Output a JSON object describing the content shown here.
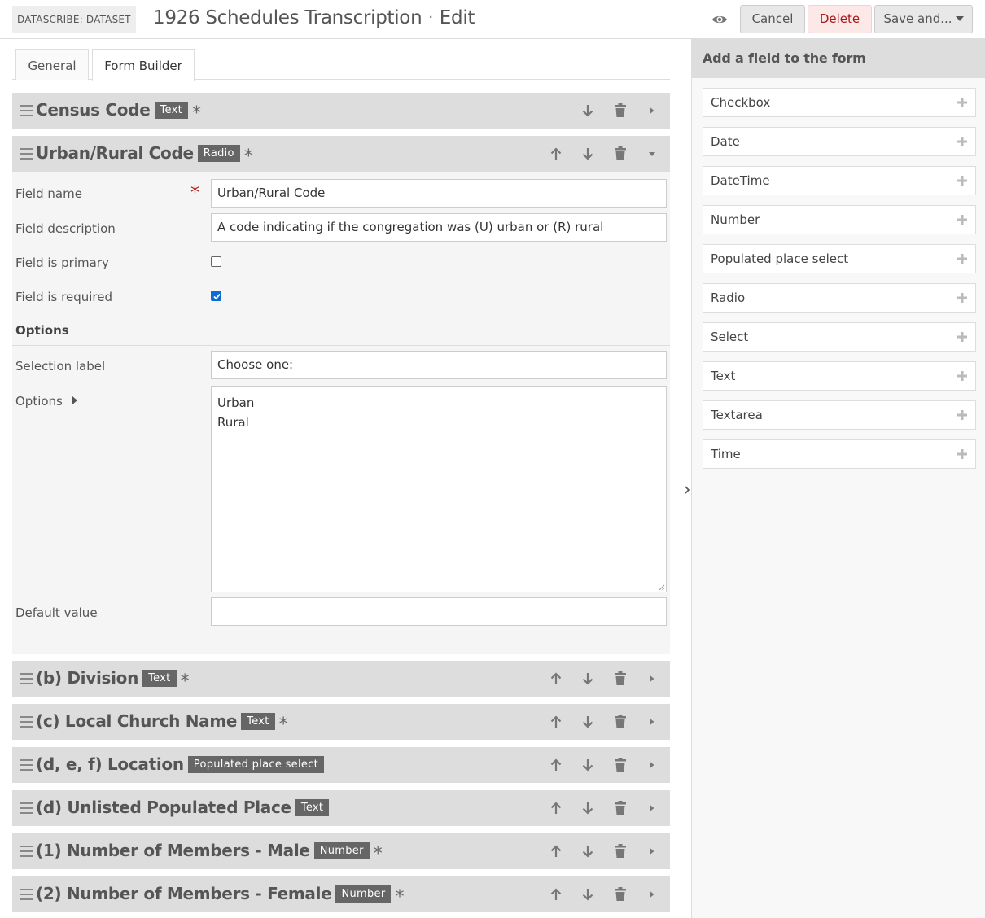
{
  "header": {
    "resource_type": "DATASCRIBE: DATASET",
    "title": "1926 Schedules Transcription",
    "separator": "·",
    "action": "Edit",
    "cancel_label": "Cancel",
    "delete_label": "Delete",
    "save_label": "Save and..."
  },
  "tabs": [
    {
      "label": "General",
      "active": false
    },
    {
      "label": "Form Builder",
      "active": true
    }
  ],
  "fields": [
    {
      "label": "Census Code",
      "type": "Text",
      "required": true,
      "expanded": false
    },
    {
      "label": "Urban/Rural Code",
      "type": "Radio",
      "required": true,
      "expanded": true
    },
    {
      "label": "(b) Division",
      "type": "Text",
      "required": true,
      "expanded": false
    },
    {
      "label": "(c) Local Church Name",
      "type": "Text",
      "required": true,
      "expanded": false
    },
    {
      "label": "(d, e, f) Location",
      "type": "Populated place select",
      "required": false,
      "expanded": false
    },
    {
      "label": "(d) Unlisted Populated Place",
      "type": "Text",
      "required": false,
      "expanded": false
    },
    {
      "label": "(1) Number of Members - Male",
      "type": "Number",
      "required": true,
      "expanded": false
    },
    {
      "label": "(2) Number of Members - Female",
      "type": "Number",
      "required": true,
      "expanded": false
    }
  ],
  "required_mark": "*",
  "field_panel": {
    "field_name_label": "Field name",
    "field_name_value": "Urban/Rural Code",
    "field_description_label": "Field description",
    "field_description_value": "A code indicating if the congregation was (U) urban or (R) rural",
    "is_primary_label": "Field is primary",
    "is_primary": false,
    "is_required_label": "Field is required",
    "is_required": true,
    "options_header": "Options",
    "selection_label_label": "Selection label",
    "selection_label_value": "Choose one:",
    "options_label": "Options",
    "options_values": [
      "Urban",
      "Rural"
    ],
    "default_value_label": "Default value",
    "default_value": ""
  },
  "sidebar": {
    "title": "Add a field to the form",
    "items": [
      "Checkbox",
      "Date",
      "DateTime",
      "Number",
      "Populated place select",
      "Radio",
      "Select",
      "Text",
      "Textarea",
      "Time"
    ]
  },
  "colors": {
    "delete": "#a91919",
    "checkbox_checked": "#0b6bd6",
    "bar": "#dddddd",
    "badge": "#666666"
  }
}
